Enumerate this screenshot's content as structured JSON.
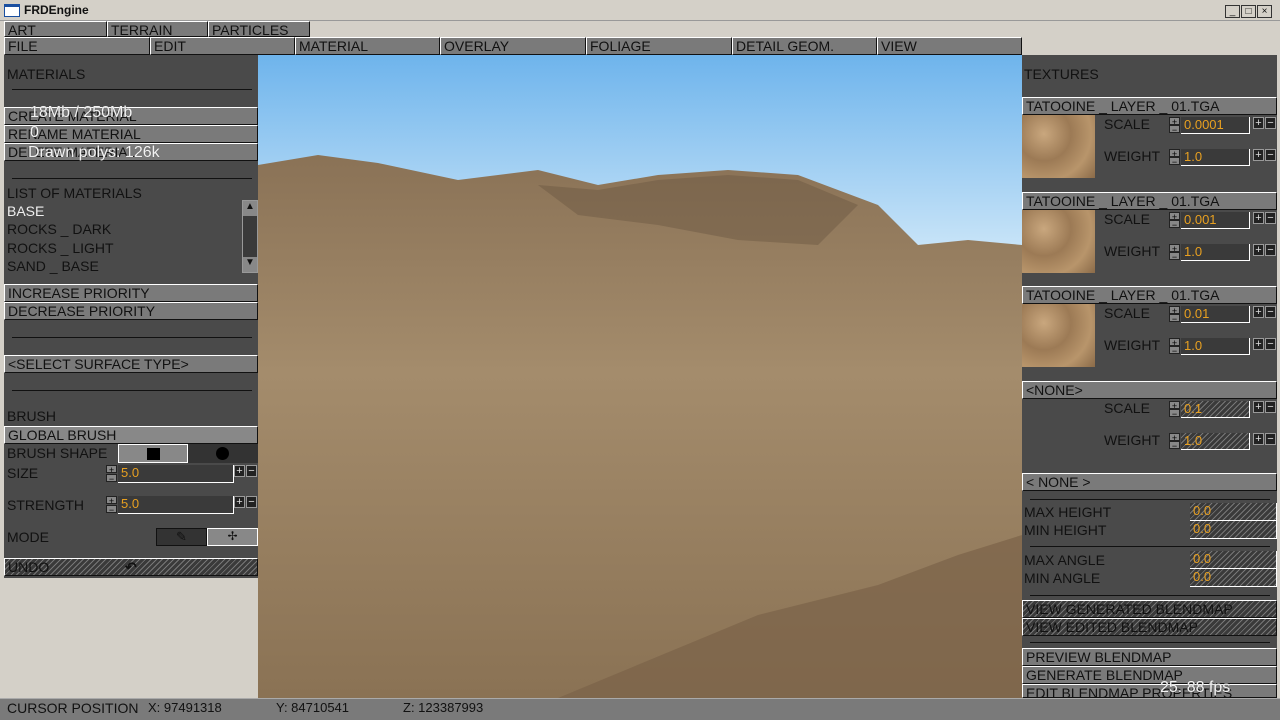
{
  "window": {
    "title": "FRDEngine"
  },
  "tabs": [
    "ART",
    "TERRAIN",
    "PARTICLES"
  ],
  "menu": [
    "FILE",
    "EDIT",
    "MATERIAL",
    "OVERLAY",
    "FOLIAGE",
    "DETAIL GEOM.",
    "VIEW"
  ],
  "left": {
    "materials_title": "MATERIALS",
    "create": "CREATE MATERIAL",
    "rename": "RENAME MATERIAL",
    "delete": "DELETE MATERIAL",
    "list_title": "LIST OF MATERIALS",
    "materials": [
      "BASE",
      "ROCKS _ DARK",
      "ROCKS _ LIGHT",
      "SAND _ BASE"
    ],
    "increase": "INCREASE PRIORITY",
    "decrease": "DECREASE PRIORITY",
    "surface": "<SELECT SURFACE TYPE>",
    "brush_title": "BRUSH",
    "global_brush": "GLOBAL BRUSH",
    "brush_shape": "BRUSH SHAPE",
    "size_label": "SIZE",
    "size": "5.0",
    "strength_label": "STRENGTH",
    "strength": "5.0",
    "mode_label": "MODE",
    "undo": "UNDO"
  },
  "overlay": {
    "memory": "18Mb / 250Mb",
    "count": "0",
    "polys": "Drawn polys: 126k",
    "fps": "25. 88  fps"
  },
  "right": {
    "title": "TEXTURES",
    "layers": [
      {
        "name": "TATOOINE _ LAYER _ 01.TGA",
        "scale": "0.0001",
        "weight": "1.0"
      },
      {
        "name": "TATOOINE _ LAYER _ 01.TGA",
        "scale": "0.001",
        "weight": "1.0"
      },
      {
        "name": "TATOOINE _ LAYER _ 01.TGA",
        "scale": "0.01",
        "weight": "1.0"
      },
      {
        "name": "<NONE>",
        "scale": "0.1",
        "weight": "1.0"
      }
    ],
    "scale_label": "SCALE",
    "weight_label": "WEIGHT",
    "none": "< NONE >",
    "max_height": "MAX HEIGHT",
    "min_height": "MIN HEIGHT",
    "max_angle": "MAX ANGLE",
    "min_angle": "MIN ANGLE",
    "max_height_v": "0.0",
    "min_height_v": "0.0",
    "max_angle_v": "0.0",
    "min_angle_v": "0.0",
    "view_generated": "VIEW GENERATED BLENDMAP",
    "view_edited": "VIEW EDITED BLENDMAP",
    "preview": "PREVIEW BLENDMAP",
    "generate": "GENERATE BLENDMAP",
    "edit_props": "EDIT BLENDMAP PROPERTIES"
  },
  "status": {
    "label": "CURSOR POSITION",
    "x": "X:  97491318",
    "y": "Y:  84710541",
    "z": "Z:  123387993"
  }
}
